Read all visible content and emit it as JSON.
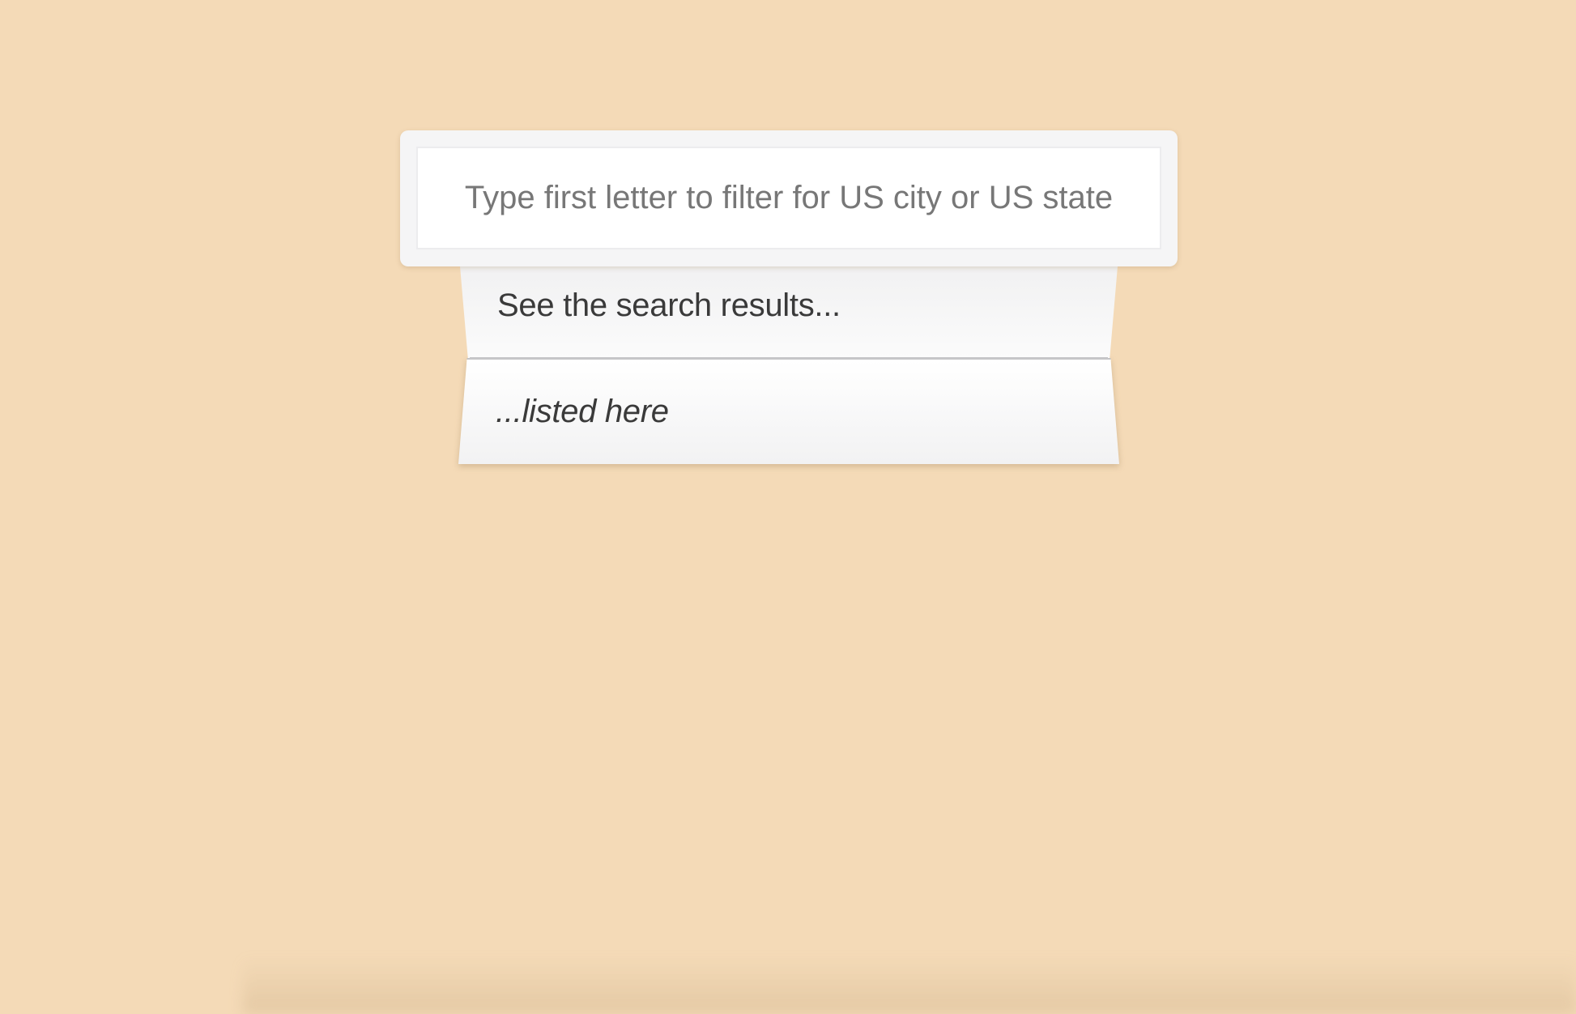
{
  "search": {
    "placeholder": "Type first letter to filter for US city or US state",
    "value": ""
  },
  "results": [
    {
      "label": "See the search results..."
    },
    {
      "label": "...listed here"
    }
  ],
  "colors": {
    "background": "#f4dab7",
    "panel": "#f5f5f6",
    "input_bg": "#ffffff",
    "placeholder_text": "#777777",
    "result_text": "#3a3a3a"
  }
}
